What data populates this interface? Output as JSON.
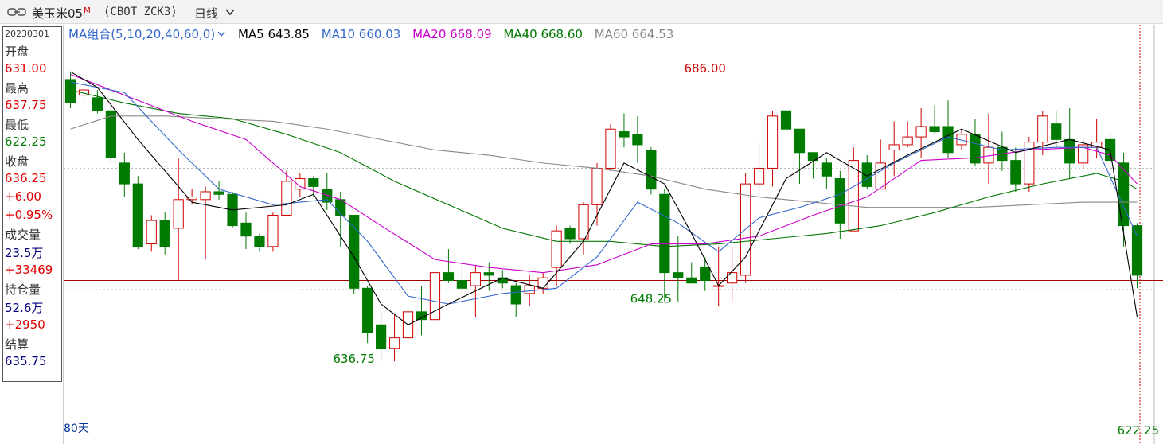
{
  "toolbar": {
    "title": "美玉米05",
    "title_sup": "M",
    "code": "(CBOT ZCK3)",
    "period": "日线"
  },
  "info_panel": {
    "date": "20230301",
    "open_label": "开盘",
    "open": "631.00",
    "high_label": "最高",
    "high": "637.75",
    "low_label": "最低",
    "low": "622.25",
    "close_label": "收盘",
    "close": "636.25",
    "change": "+6.00",
    "change_pct": "+0.95%",
    "volume_label": "成交量",
    "volume": "23.5万",
    "volume_change": "+33469",
    "oi_label": "持仓量",
    "oi": "52.6万",
    "oi_change": "+2950",
    "settle_label": "结算",
    "settle": "635.75"
  },
  "legend": {
    "group": "MA组合(5,10,20,40,60,0)",
    "ma5": "MA5 643.85",
    "ma10": "MA10 660.03",
    "ma20": "MA20 668.09",
    "ma40": "MA40 668.60",
    "ma60": "MA60 664.53"
  },
  "colors": {
    "up": "#d00000",
    "down": "#007a00",
    "ma5": "#000000",
    "ma10": "#3366cc",
    "ma20": "#cc00cc",
    "ma40": "#007700",
    "ma60": "#888888"
  },
  "footer": {
    "days": "80天"
  },
  "chart_data": {
    "type": "candlestick",
    "title": "",
    "ylim": [
      620,
      695
    ],
    "annotations": [
      {
        "text": "686.00",
        "index": 47,
        "value": 686.0
      },
      {
        "text": "636.75",
        "index": 21,
        "value": 636.75
      },
      {
        "text": "648.25",
        "index": 43,
        "value": 648.25
      },
      {
        "text": "622.25",
        "index": 79,
        "value": 622.25
      }
    ],
    "reference_line": 649.5,
    "dashed_lines": [
      671.0,
      647.75
    ],
    "candles": [
      [
        688.0,
        683.5,
        689.5,
        682.5
      ],
      [
        685.0,
        686.0,
        688.5,
        684.0
      ],
      [
        684.5,
        682.0,
        686.0,
        681.5
      ],
      [
        682.0,
        673.0,
        683.0,
        672.0
      ],
      [
        672.0,
        668.0,
        674.0,
        665.5
      ],
      [
        668.0,
        656.0,
        669.5,
        655.5
      ],
      [
        656.5,
        661.0,
        662.0,
        655.0
      ],
      [
        661.0,
        656.0,
        662.5,
        654.5
      ],
      [
        659.5,
        665.0,
        673.0,
        649.5
      ],
      [
        665.0,
        665.5,
        667.0,
        664.0
      ],
      [
        665.0,
        666.5,
        667.5,
        653.5
      ],
      [
        666.5,
        666.0,
        668.5,
        665.0
      ],
      [
        666.0,
        660.0,
        666.5,
        659.5
      ],
      [
        660.5,
        658.0,
        662.5,
        655.5
      ],
      [
        658.0,
        656.0,
        658.5,
        655.0
      ],
      [
        656.0,
        662.0,
        662.5,
        655.0
      ],
      [
        662.0,
        668.5,
        670.5,
        662.0
      ],
      [
        667.0,
        669.0,
        670.0,
        665.5
      ],
      [
        669.0,
        667.5,
        669.5,
        665.5
      ],
      [
        667.0,
        664.5,
        670.0,
        663.0
      ],
      [
        665.0,
        662.0,
        666.5,
        656.0
      ],
      [
        662.0,
        648.0,
        662.0,
        647.0
      ],
      [
        648.0,
        639.5,
        648.5,
        637.5
      ],
      [
        641.0,
        636.5,
        643.5,
        634.0
      ],
      [
        636.5,
        638.5,
        643.0,
        634.0
      ],
      [
        638.5,
        643.5,
        644.0,
        637.5
      ],
      [
        643.5,
        642.0,
        648.5,
        639.0
      ],
      [
        642.0,
        651.0,
        652.0,
        641.0
      ],
      [
        651.0,
        649.5,
        655.5,
        649.0
      ],
      [
        649.5,
        648.0,
        652.5,
        646.0
      ],
      [
        648.5,
        651.0,
        652.5,
        642.5
      ],
      [
        651.0,
        650.5,
        653.0,
        647.5
      ],
      [
        650.0,
        649.0,
        651.5,
        648.0
      ],
      [
        648.5,
        645.0,
        649.0,
        642.5
      ],
      [
        647.0,
        648.5,
        650.5,
        644.5
      ],
      [
        648.0,
        650.0,
        651.0,
        647.0
      ],
      [
        652.0,
        659.0,
        660.0,
        648.5
      ],
      [
        659.5,
        657.5,
        660.0,
        656.5
      ],
      [
        657.5,
        664.0,
        664.5,
        654.5
      ],
      [
        664.0,
        671.0,
        672.0,
        660.0
      ],
      [
        671.0,
        678.5,
        679.5,
        670.5
      ],
      [
        678.0,
        677.0,
        681.5,
        675.0
      ],
      [
        677.5,
        675.5,
        681.0,
        672.0
      ],
      [
        674.5,
        667.0,
        675.0,
        666.0
      ],
      [
        666.0,
        651.0,
        667.0,
        645.5
      ],
      [
        651.0,
        650.0,
        658.0,
        645.5
      ],
      [
        650.0,
        649.0,
        653.0,
        649.0
      ],
      [
        652.0,
        649.5,
        654.0,
        647.5
      ],
      [
        648.5,
        648.5,
        656.0,
        644.5
      ],
      [
        649.0,
        651.0,
        656.0,
        645.5
      ],
      [
        650.5,
        668.0,
        670.0,
        649.0
      ],
      [
        668.0,
        671.0,
        676.0,
        666.0
      ],
      [
        671.0,
        681.0,
        682.0,
        667.5
      ],
      [
        682.0,
        678.5,
        686.0,
        674.0
      ],
      [
        678.5,
        674.0,
        678.0,
        668.0
      ],
      [
        674.0,
        672.5,
        674.0,
        669.0
      ],
      [
        672.0,
        669.5,
        673.0,
        667.0
      ],
      [
        669.0,
        660.5,
        670.5,
        657.5
      ],
      [
        659.0,
        672.5,
        675.0,
        663.5
      ],
      [
        672.0,
        667.5,
        673.5,
        667.0
      ],
      [
        667.0,
        672.0,
        676.5,
        670.5
      ],
      [
        674.5,
        675.5,
        680.0,
        669.5
      ],
      [
        675.5,
        677.0,
        680.0,
        675.0
      ],
      [
        677.0,
        679.0,
        682.5,
        673.0
      ],
      [
        679.0,
        678.0,
        683.0,
        677.5
      ],
      [
        679.0,
        674.0,
        684.0,
        673.0
      ],
      [
        675.5,
        677.5,
        678.5,
        674.5
      ],
      [
        677.5,
        672.0,
        680.5,
        671.5
      ],
      [
        672.0,
        675.0,
        681.5,
        668.0
      ],
      [
        675.0,
        672.5,
        678.0,
        670.5
      ],
      [
        672.5,
        668.0,
        675.0,
        666.5
      ],
      [
        668.0,
        676.0,
        677.0,
        666.5
      ],
      [
        676.0,
        681.0,
        682.0,
        673.5
      ],
      [
        679.5,
        676.5,
        682.0,
        675.0
      ],
      [
        676.5,
        672.0,
        682.5,
        669.0
      ],
      [
        672.0,
        675.5,
        676.5,
        671.0
      ],
      [
        675.0,
        676.0,
        680.5,
        673.0
      ],
      [
        676.5,
        672.5,
        678.0,
        667.0
      ],
      [
        672.0,
        660.0,
        674.0,
        656.0
      ],
      [
        660.0,
        650.5,
        660.5,
        648.0
      ]
    ],
    "ma5": [
      [
        0,
        689.5
      ],
      [
        2,
        686.5
      ],
      [
        5,
        676.5
      ],
      [
        9,
        664.5
      ],
      [
        12,
        663.0
      ],
      [
        16,
        664.0
      ],
      [
        18,
        666.0
      ],
      [
        21,
        654.0
      ],
      [
        23,
        645.0
      ],
      [
        25,
        641.0
      ],
      [
        28,
        645.0
      ],
      [
        32,
        650.0
      ],
      [
        35,
        648.0
      ],
      [
        38,
        657.0
      ],
      [
        41,
        672.0
      ],
      [
        44,
        668.0
      ],
      [
        46,
        658.5
      ],
      [
        48,
        648.5
      ],
      [
        50,
        654.0
      ],
      [
        53,
        669.0
      ],
      [
        56,
        674.0
      ],
      [
        59,
        669.5
      ],
      [
        62,
        673.5
      ],
      [
        66,
        678.5
      ],
      [
        70,
        674.0
      ],
      [
        74,
        676.5
      ],
      [
        77,
        674.5
      ],
      [
        79,
        642.5
      ]
    ],
    "ma10": [
      [
        0,
        687.5
      ],
      [
        4,
        685.5
      ],
      [
        8,
        674.5
      ],
      [
        11,
        667.0
      ],
      [
        15,
        664.0
      ],
      [
        19,
        665.0
      ],
      [
        22,
        657.0
      ],
      [
        25,
        646.5
      ],
      [
        28,
        645.0
      ],
      [
        32,
        647.0
      ],
      [
        36,
        648.0
      ],
      [
        39,
        654.0
      ],
      [
        42,
        664.5
      ],
      [
        45,
        660.5
      ],
      [
        48,
        655.0
      ],
      [
        51,
        661.5
      ],
      [
        54,
        663.5
      ],
      [
        57,
        666.0
      ],
      [
        61,
        672.0
      ],
      [
        65,
        677.0
      ],
      [
        69,
        674.5
      ],
      [
        73,
        675.0
      ],
      [
        76,
        675.0
      ],
      [
        79,
        658.0
      ]
    ],
    "ma20": [
      [
        0,
        689.0
      ],
      [
        5,
        684.0
      ],
      [
        9,
        680.0
      ],
      [
        13,
        676.5
      ],
      [
        17,
        667.5
      ],
      [
        20,
        665.0
      ],
      [
        23,
        660.0
      ],
      [
        27,
        653.5
      ],
      [
        31,
        652.0
      ],
      [
        35,
        651.0
      ],
      [
        39,
        652.5
      ],
      [
        43,
        656.5
      ],
      [
        47,
        656.5
      ],
      [
        51,
        658.0
      ],
      [
        55,
        662.0
      ],
      [
        59,
        665.5
      ],
      [
        63,
        672.5
      ],
      [
        67,
        673.0
      ],
      [
        71,
        674.5
      ],
      [
        75,
        675.0
      ],
      [
        77,
        673.5
      ],
      [
        79,
        668.0
      ]
    ],
    "ma40": [
      [
        0,
        686.0
      ],
      [
        4,
        683.5
      ],
      [
        8,
        681.5
      ],
      [
        12,
        680.5
      ],
      [
        16,
        677.5
      ],
      [
        20,
        674.0
      ],
      [
        24,
        668.5
      ],
      [
        28,
        664.0
      ],
      [
        32,
        659.5
      ],
      [
        36,
        657.0
      ],
      [
        40,
        657.0
      ],
      [
        44,
        656.0
      ],
      [
        48,
        656.5
      ],
      [
        52,
        657.5
      ],
      [
        56,
        658.5
      ],
      [
        60,
        660.0
      ],
      [
        64,
        662.5
      ],
      [
        68,
        665.5
      ],
      [
        72,
        668.0
      ],
      [
        76,
        670.0
      ],
      [
        78,
        668.5
      ],
      [
        79,
        667.0
      ]
    ],
    "ma60": [
      [
        0,
        678.5
      ],
      [
        3,
        681.0
      ],
      [
        7,
        681.0
      ],
      [
        11,
        680.5
      ],
      [
        15,
        680.0
      ],
      [
        19,
        678.5
      ],
      [
        23,
        676.5
      ],
      [
        27,
        674.5
      ],
      [
        31,
        673.5
      ],
      [
        35,
        672.0
      ],
      [
        39,
        671.0
      ],
      [
        43,
        669.5
      ],
      [
        47,
        667.0
      ],
      [
        51,
        665.5
      ],
      [
        55,
        664.5
      ],
      [
        59,
        663.5
      ],
      [
        63,
        663.5
      ],
      [
        67,
        663.5
      ],
      [
        71,
        664.0
      ],
      [
        75,
        664.5
      ],
      [
        79,
        664.5
      ]
    ]
  }
}
